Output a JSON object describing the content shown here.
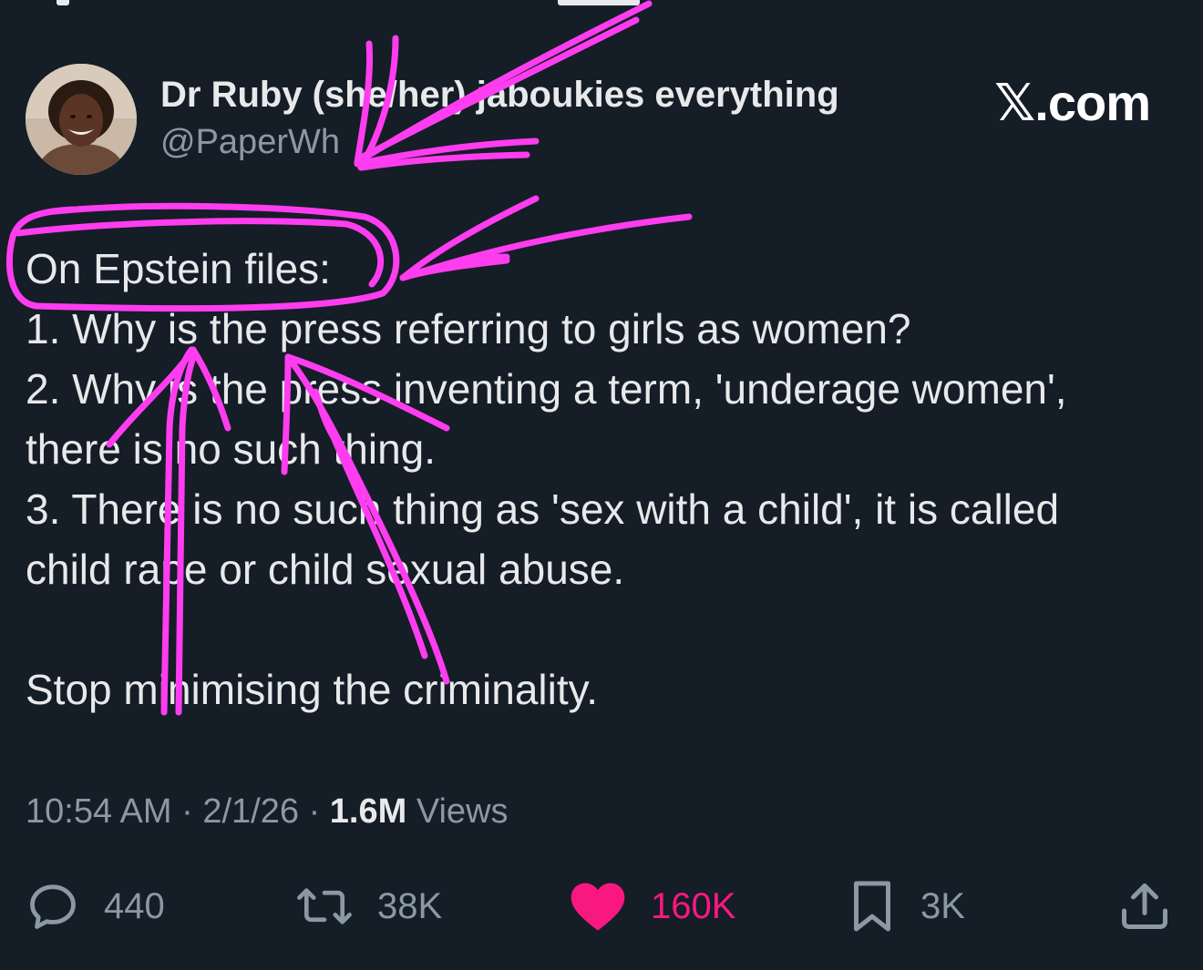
{
  "author": {
    "display_name": "Dr Ruby (she/her) jaboukies everything",
    "handle": "@PaperWh"
  },
  "brand": {
    "x_glyph": "𝕏",
    "suffix": ".com"
  },
  "tweet": {
    "lines": [
      "On Epstein files:",
      "1. Why is the press referring to girls as women?",
      "2. Why is the press inventing a term, 'underage women',",
      "there is no such thing.",
      "3. There is no such thing as 'sex with a child', it is called",
      "child rape or child sexual abuse.",
      "",
      "Stop minimising the criminality."
    ]
  },
  "meta": {
    "time": "10:54 AM",
    "separator": "·",
    "date": "2/1/26",
    "views_count": "1.6M",
    "views_label": "Views"
  },
  "actions": {
    "reply": {
      "icon": "reply-icon",
      "count": "440"
    },
    "repost": {
      "icon": "repost-icon",
      "count": "38K"
    },
    "like": {
      "icon": "heart-icon",
      "count": "160K",
      "color": "#f91880"
    },
    "bookmark": {
      "icon": "bookmark-icon",
      "count": "3K"
    },
    "share": {
      "icon": "share-icon"
    }
  },
  "colors": {
    "background": "#151d27",
    "text": "#e7e9ea",
    "secondary": "#8b98a5",
    "annotation": "#ff3df0"
  }
}
